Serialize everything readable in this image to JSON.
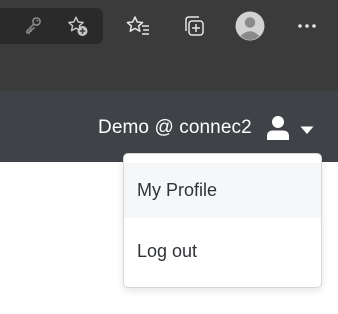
{
  "browser": {
    "icons": [
      "key-icon",
      "add-favorite-icon",
      "favorites-icon",
      "collections-icon",
      "profile-avatar-icon",
      "more-icon"
    ]
  },
  "navbar": {
    "user_label": "Demo @ connec2",
    "user_icon": "user-icon",
    "caret_icon": "caret-down-icon"
  },
  "dropdown": {
    "items": [
      {
        "label": "My Profile",
        "highlighted": true
      },
      {
        "label": "Log out",
        "highlighted": false
      }
    ]
  },
  "colors": {
    "browser_toolbar": "#3b3b3b",
    "address_bar": "#2a2a2a",
    "navbar": "#3f4347",
    "menu_text": "#2f3337",
    "menu_hover": "#f6f7f8"
  }
}
